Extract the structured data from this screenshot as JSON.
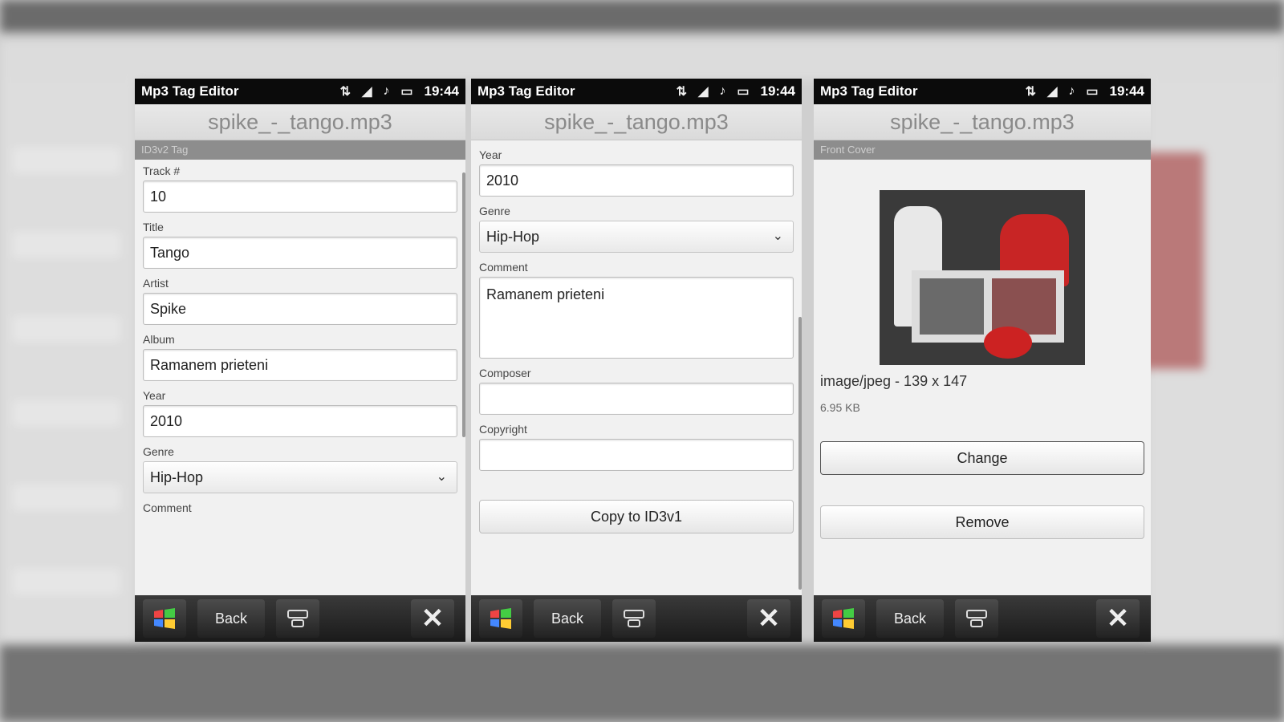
{
  "app_title": "Mp3 Tag Editor",
  "status_time": "19:44",
  "status_icons": [
    "network-icon",
    "signal-icon",
    "music-note-icon",
    "battery-icon"
  ],
  "file_name": "spike_-_tango.mp3",
  "screen1": {
    "section": "ID3v2 Tag",
    "fields": [
      {
        "label": "Track #",
        "value": "10"
      },
      {
        "label": "Title",
        "value": "Tango"
      },
      {
        "label": "Artist",
        "value": "Spike"
      },
      {
        "label": "Album",
        "value": "Ramanem prieteni"
      },
      {
        "label": "Year",
        "value": "2010"
      }
    ],
    "genre_label": "Genre",
    "genre_value": "Hip-Hop",
    "comment_label": "Comment"
  },
  "screen2": {
    "year_label": "Year",
    "year_value": "2010",
    "genre_label": "Genre",
    "genre_value": "Hip-Hop",
    "comment_label": "Comment",
    "comment_value": "Ramanem prieteni",
    "composer_label": "Composer",
    "composer_value": "",
    "copyright_label": "Copyright",
    "copyright_value": "",
    "copy_button": "Copy to ID3v1"
  },
  "screen3": {
    "section": "Front Cover",
    "image_info": "image/jpeg - 139 x 147",
    "image_size": "6.95 KB",
    "change_button": "Change",
    "remove_button": "Remove"
  },
  "toolbar": {
    "back_label": "Back"
  },
  "colors": {
    "statusbar": "#0b0b0b",
    "section_bar": "#8d8d8d",
    "toolbar": "#222222"
  }
}
